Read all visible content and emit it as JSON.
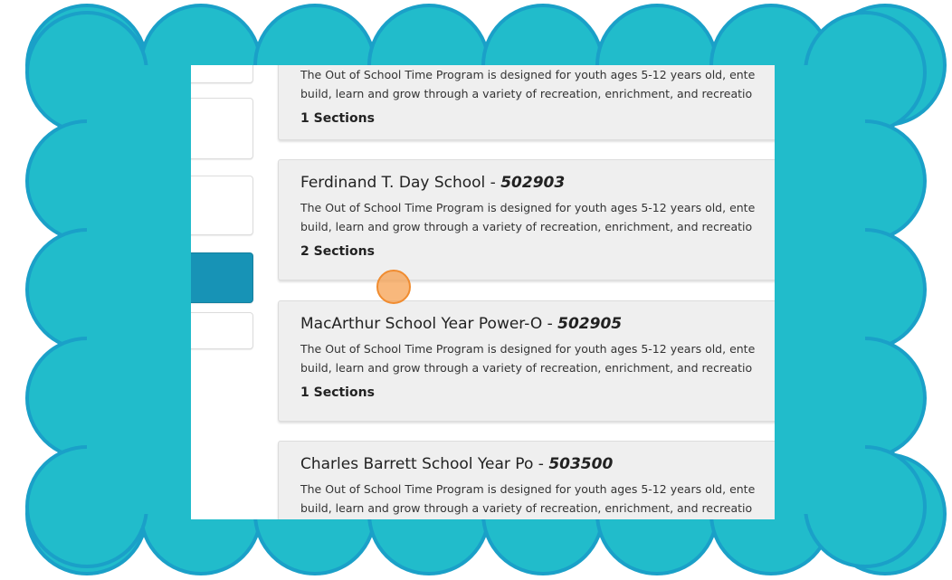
{
  "colors": {
    "frame": "#21bccb",
    "frame_border": "#1aa0c8",
    "active_tab": "#1793b6",
    "card_bg": "#efefef",
    "cursor": "#f5a050"
  },
  "programs": [
    {
      "title": "",
      "code": "",
      "desc_line1": "The Out of School Time Program is designed for youth ages 5-12 years old, ente",
      "desc_line2": "build, learn and grow through a variety of recreation, enrichment, and recreatio",
      "sections": "1 Sections"
    },
    {
      "title": "Ferdinand T. Day School - ",
      "code": "502903",
      "desc_line1": "The Out of School Time Program is designed for youth ages 5-12 years old, ente",
      "desc_line2": "build, learn and grow through a variety of recreation, enrichment, and recreatio",
      "sections": "2 Sections"
    },
    {
      "title": "MacArthur School Year Power-O - ",
      "code": "502905",
      "desc_line1": "The Out of School Time Program is designed for youth ages 5-12 years old, ente",
      "desc_line2": "build, learn and grow through a variety of recreation, enrichment, and recreatio",
      "sections": "1 Sections"
    },
    {
      "title": "Charles Barrett School Year Po - ",
      "code": "503500",
      "desc_line1": "The Out of School Time Program is designed for youth ages 5-12 years old, ente",
      "desc_line2": "build, learn and grow through a variety of recreation, enrichment, and recreatio",
      "sections": ""
    }
  ]
}
